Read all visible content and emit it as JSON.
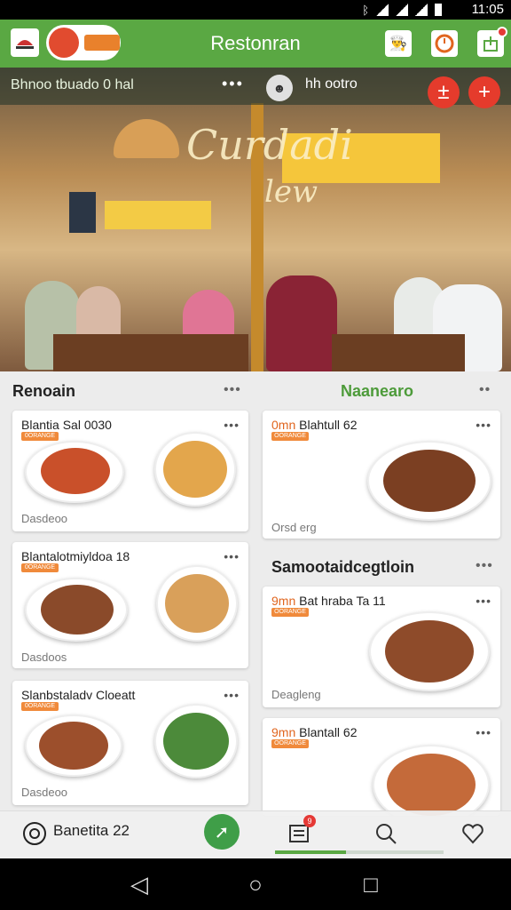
{
  "status_bar": {
    "time": "11:05"
  },
  "app_bar": {
    "title": "Restonran"
  },
  "hero": {
    "strip_label": "Bhnoo tbuado 0 hal",
    "strip_label2": "hh ootro",
    "overlay_title": "Curdadi",
    "overlay_title2": "lew"
  },
  "sections": {
    "left_title": "Renoain",
    "right_title": "Naanearo",
    "right_title2": "Samootaidcegtloin"
  },
  "cards": [
    {
      "title": "Blantia Sal 0030",
      "tag": "0ORANGE",
      "footer": "Dasdeoo"
    },
    {
      "title": "Blantalotmiyldoa 18",
      "tag": "0ORANGE",
      "footer": "Dasdoos"
    },
    {
      "title": "Slanbstaladv Cloeatt",
      "tag": "0ORANGE",
      "footer": "Dasdeoo"
    },
    {
      "title_num": "0mn",
      "title": "Blahtull 62",
      "tag": "OORANGE",
      "footer": "Orsd erg"
    },
    {
      "title_num": "9mn",
      "title": "Bat hraba Ta 11",
      "tag": "OORANGE",
      "footer": "Deagleng"
    },
    {
      "title_num": "9mn",
      "title": "Blantall 62",
      "tag": "OORANGE",
      "footer": ""
    }
  ],
  "bottom_nav": {
    "left_label": "Banetita 22",
    "notif_count": "9",
    "progress": 0.42
  },
  "icons": {
    "app_logo": "restaurant-logo-icon",
    "profile": "chef-icon",
    "timer": "timer-icon",
    "share": "share-icon",
    "add": "plus-icon",
    "search": "search-icon",
    "heart": "heart-icon",
    "menu": "list-icon",
    "back": "back-icon",
    "home": "home-icon",
    "recents": "recents-icon"
  }
}
